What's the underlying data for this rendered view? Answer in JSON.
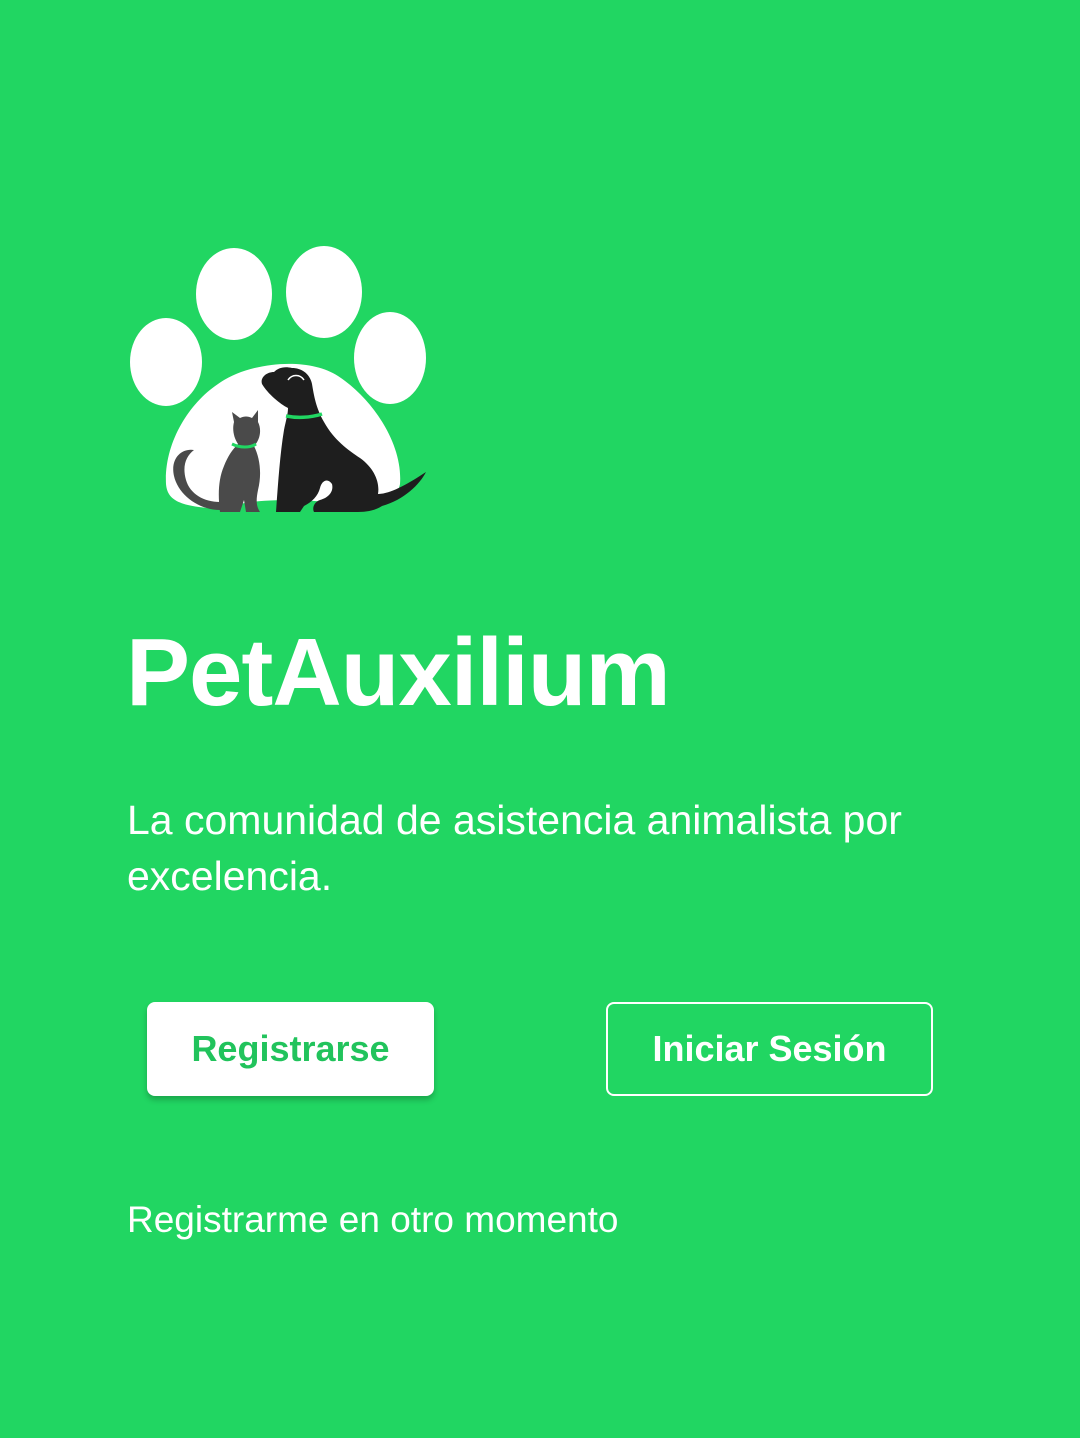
{
  "app": {
    "title": "PetAuxilium",
    "tagline": "La comunidad de asistencia animalista por excelencia."
  },
  "logo": {
    "icon": "paw-with-cat-and-dog-icon"
  },
  "actions": {
    "register_label": "Registrarse",
    "login_label": "Iniciar Sesión",
    "skip_label": "Registrarme en otro momento"
  },
  "colors": {
    "background": "#21d662",
    "primary_button_text": "#21c35c",
    "text": "#ffffff",
    "silhouette": "#4a4a4a",
    "collar": "#21d662"
  }
}
